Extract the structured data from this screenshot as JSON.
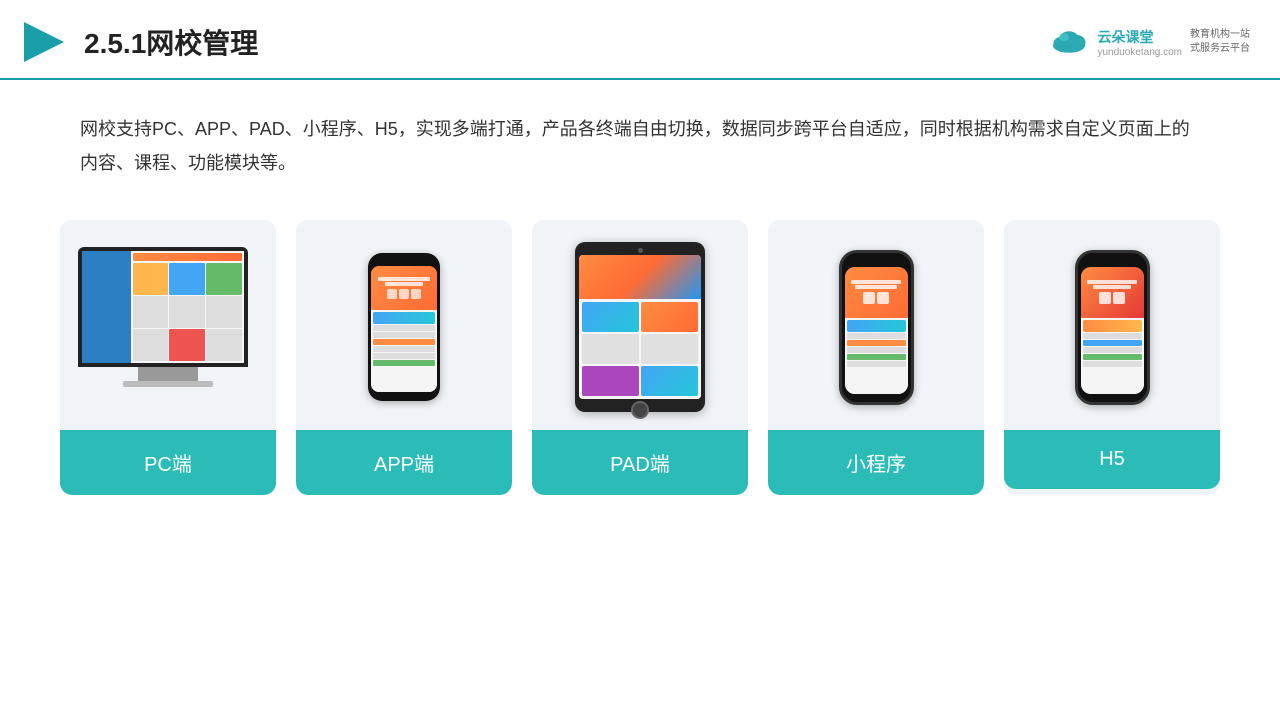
{
  "header": {
    "title": "2.5.1网校管理",
    "logo": {
      "name": "云朵课堂",
      "url": "yunduoketang.com",
      "tagline": "教育机构一站\n式服务云平台"
    }
  },
  "description": "网校支持PC、APP、PAD、小程序、H5，实现多端打通，产品各终端自由切换，数据同步跨平台自适应，同时根据机构需求自定义页面上的内容、课程、功能模块等。",
  "cards": [
    {
      "id": "pc",
      "label": "PC端"
    },
    {
      "id": "app",
      "label": "APP端"
    },
    {
      "id": "pad",
      "label": "PAD端"
    },
    {
      "id": "miniapp",
      "label": "小程序"
    },
    {
      "id": "h5",
      "label": "H5"
    }
  ],
  "colors": {
    "accent": "#2bbcb8",
    "border": "#1a9fa8",
    "title": "#222222",
    "text": "#333333"
  }
}
